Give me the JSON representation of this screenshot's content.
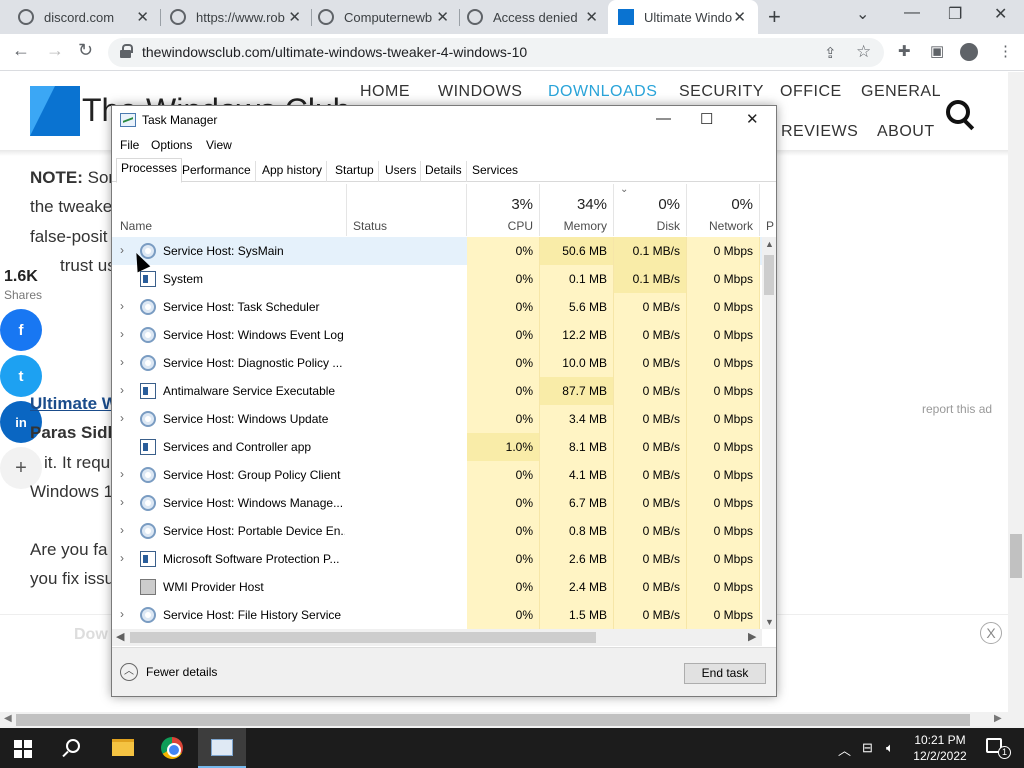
{
  "browser": {
    "tabs": [
      {
        "title": "discord.com",
        "active": false
      },
      {
        "title": "https://www.rob",
        "active": false
      },
      {
        "title": "Computernewb",
        "active": false
      },
      {
        "title": "Access denied",
        "active": false
      },
      {
        "title": "Ultimate Windo",
        "active": true
      }
    ],
    "url": "thewindowsclub.com/ultimate-windows-tweaker-4-windows-10"
  },
  "site": {
    "logo": "The Windows Club",
    "nav": [
      "HOME",
      "WINDOWS",
      "DOWNLOADS",
      "SECURITY",
      "OFFICE",
      "GENERAL",
      "REVIEWS",
      "ABOUT"
    ],
    "nav_active": "DOWNLOADS",
    "note_bold": "NOTE:",
    "note_line1": " Sor",
    "note_line2": "the tweake",
    "note_line3": "false-posit",
    "note_line4": "trust us.",
    "share_count": "1.6K",
    "share_label": "Shares",
    "share_buttons": [
      "facebook",
      "twitter",
      "linkedin",
      "more"
    ],
    "heading": "Ultimate W",
    "author": "Paras Sidh",
    "para1": "it. It requ",
    "para2": "Windows 1",
    "para3": "Are you fa",
    "para4": "you fix issu",
    "report": "report this ad",
    "ad_label": "Dow"
  },
  "taskmanager": {
    "title": "Task Manager",
    "menu": [
      "File",
      "Options",
      "View"
    ],
    "tabs": [
      "Processes",
      "Performance",
      "App history",
      "Startup",
      "Users",
      "Details",
      "Services"
    ],
    "active_tab": "Processes",
    "columns": {
      "name": "Name",
      "status": "Status",
      "cpu": {
        "pct": "3%",
        "label": "CPU"
      },
      "memory": {
        "pct": "34%",
        "label": "Memory"
      },
      "disk": {
        "pct": "0%",
        "label": "Disk"
      },
      "network": {
        "pct": "0%",
        "label": "Network"
      },
      "power": "P"
    },
    "processes": [
      {
        "name": "Service Host: SysMain",
        "expandable": true,
        "icon": "gear",
        "cpu": "0%",
        "memory": "50.6 MB",
        "disk": "0.1 MB/s",
        "network": "0 Mbps",
        "highlighted": true
      },
      {
        "name": "System",
        "expandable": false,
        "icon": "win",
        "cpu": "0%",
        "memory": "0.1 MB",
        "disk": "0.1 MB/s",
        "network": "0 Mbps"
      },
      {
        "name": "Service Host: Task Scheduler",
        "expandable": true,
        "icon": "gear",
        "cpu": "0%",
        "memory": "5.6 MB",
        "disk": "0 MB/s",
        "network": "0 Mbps"
      },
      {
        "name": "Service Host: Windows Event Log",
        "expandable": true,
        "icon": "gear",
        "cpu": "0%",
        "memory": "12.2 MB",
        "disk": "0 MB/s",
        "network": "0 Mbps"
      },
      {
        "name": "Service Host: Diagnostic Policy ...",
        "expandable": true,
        "icon": "gear",
        "cpu": "0%",
        "memory": "10.0 MB",
        "disk": "0 MB/s",
        "network": "0 Mbps"
      },
      {
        "name": "Antimalware Service Executable",
        "expandable": true,
        "icon": "win",
        "cpu": "0%",
        "memory": "87.7 MB",
        "disk": "0 MB/s",
        "network": "0 Mbps"
      },
      {
        "name": "Service Host: Windows Update",
        "expandable": true,
        "icon": "gear",
        "cpu": "0%",
        "memory": "3.4 MB",
        "disk": "0 MB/s",
        "network": "0 Mbps"
      },
      {
        "name": "Services and Controller app",
        "expandable": false,
        "icon": "win",
        "cpu": "1.0%",
        "memory": "8.1 MB",
        "disk": "0 MB/s",
        "network": "0 Mbps"
      },
      {
        "name": "Service Host: Group Policy Client",
        "expandable": true,
        "icon": "gear",
        "cpu": "0%",
        "memory": "4.1 MB",
        "disk": "0 MB/s",
        "network": "0 Mbps"
      },
      {
        "name": "Service Host: Windows Manage...",
        "expandable": true,
        "icon": "gear",
        "cpu": "0%",
        "memory": "6.7 MB",
        "disk": "0 MB/s",
        "network": "0 Mbps"
      },
      {
        "name": "Service Host: Portable Device En...",
        "expandable": true,
        "icon": "gear",
        "cpu": "0%",
        "memory": "0.8 MB",
        "disk": "0 MB/s",
        "network": "0 Mbps"
      },
      {
        "name": "Microsoft Software Protection P...",
        "expandable": true,
        "icon": "win",
        "cpu": "0%",
        "memory": "2.6 MB",
        "disk": "0 MB/s",
        "network": "0 Mbps"
      },
      {
        "name": "WMI Provider Host",
        "expandable": false,
        "icon": "wmi",
        "cpu": "0%",
        "memory": "2.4 MB",
        "disk": "0 MB/s",
        "network": "0 Mbps"
      },
      {
        "name": "Service Host: File History Service",
        "expandable": true,
        "icon": "gear",
        "cpu": "0%",
        "memory": "1.5 MB",
        "disk": "0 MB/s",
        "network": "0 Mbps"
      }
    ],
    "fewer_details": "Fewer details",
    "end_task": "End task"
  },
  "taskbar": {
    "time": "10:21 PM",
    "date": "12/2/2022",
    "notification_count": "1"
  },
  "colors": {
    "heat_light": "#fff4c4",
    "heat_medium": "#f9eca8",
    "row_highlight": "#e5f1fb",
    "nav_active": "#2aa4d9",
    "taskbar": "#1c1c1c"
  }
}
